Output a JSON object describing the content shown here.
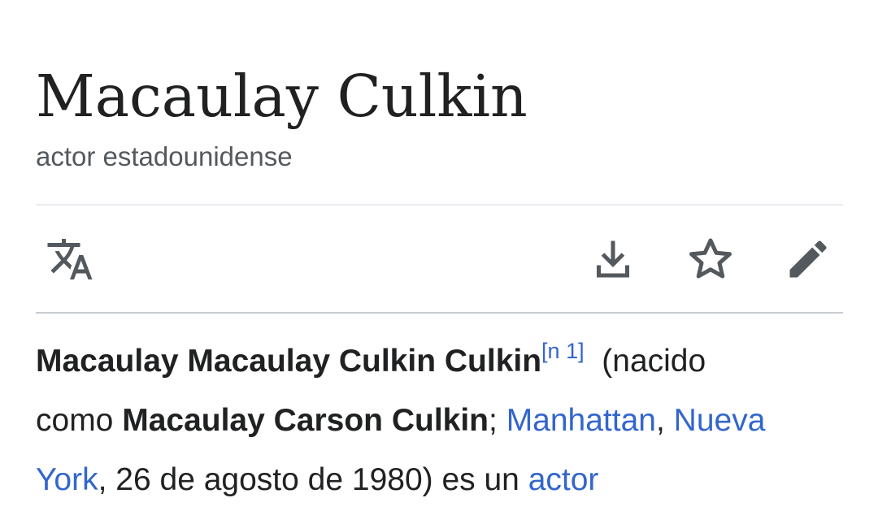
{
  "article": {
    "title": "Macaulay Culkin",
    "description": "actor estadounidense"
  },
  "toolbar": {
    "language_icon": "translate-icon",
    "download_icon": "download-icon",
    "star_icon": "star-icon",
    "edit_icon": "pencil-icon"
  },
  "lead": {
    "bold_name": "Macaulay Macaulay Culkin Culkin",
    "ref": "[n 1]",
    "after_ref": "  (nacido",
    "como": "como ",
    "birth_name": "Macaulay Carson Culkin",
    "semicolon": "; ",
    "link_manhattan": "Manhattan",
    "comma": ", ",
    "link_nueva_york_1": "Nueva",
    "link_nueva_york_2": "York",
    "date_text": ", 26 de agosto de 1980) es un ",
    "link_actor": "actor"
  },
  "colors": {
    "link": "#3366cc",
    "text": "#202122",
    "muted": "#54595d"
  }
}
